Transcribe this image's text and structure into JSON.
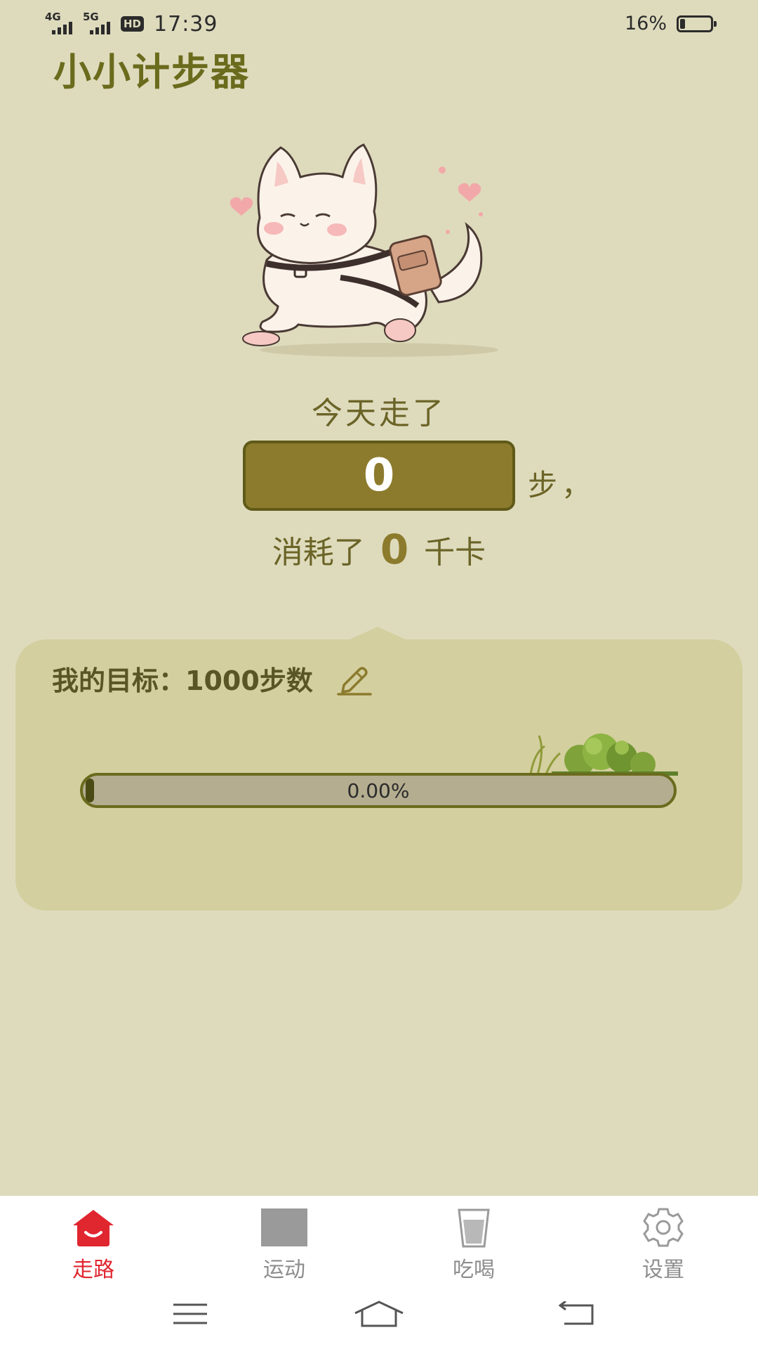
{
  "status_bar": {
    "network_1": "4G",
    "network_2": "5G",
    "hd_badge": "HD",
    "time": "17:39",
    "battery_percent": "16%",
    "battery_level": 0.16
  },
  "app": {
    "title": "小小计步器"
  },
  "stats": {
    "today_label": "今天走了",
    "steps": "0",
    "steps_unit": "步，",
    "consumed_label": "消耗了",
    "kcal": "0",
    "kcal_unit": "千卡"
  },
  "goal": {
    "label": "我的目标：1000步数",
    "progress_text": "0.00%",
    "progress_value": 0
  },
  "tabs": [
    {
      "label": "走路",
      "icon": "home-icon",
      "active": true
    },
    {
      "label": "运动",
      "icon": "exercise-icon",
      "active": false
    },
    {
      "label": "吃喝",
      "icon": "cup-icon",
      "active": false
    },
    {
      "label": "设置",
      "icon": "gear-icon",
      "active": false
    }
  ],
  "colors": {
    "background": "#dedbbd",
    "accent": "#8c7b2d",
    "title": "#6b6b1d",
    "tab_active": "#e0262f",
    "tab_inactive": "#8d8d8d"
  }
}
